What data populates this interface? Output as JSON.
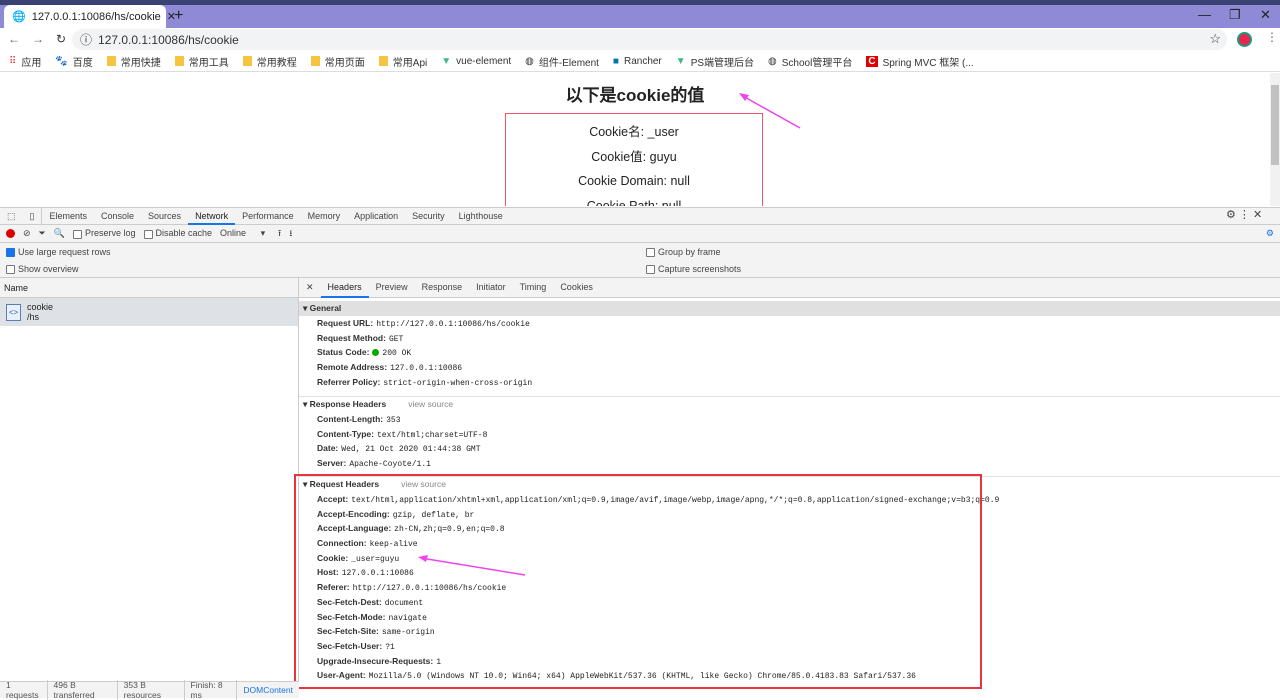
{
  "browser": {
    "tab_title": "127.0.0.1:10086/hs/cookie",
    "url": "127.0.0.1:10086/hs/cookie",
    "bookmarks": [
      {
        "label": "应用",
        "icon": "apps-icon"
      },
      {
        "label": "百度",
        "icon": "baidu-icon"
      },
      {
        "label": "常用快捷",
        "icon": "folder-icon"
      },
      {
        "label": "常用工具",
        "icon": "folder-icon"
      },
      {
        "label": "常用教程",
        "icon": "folder-icon"
      },
      {
        "label": "常用页面",
        "icon": "folder-icon"
      },
      {
        "label": "常用Api",
        "icon": "folder-icon"
      },
      {
        "label": "vue-element",
        "icon": "vue-icon"
      },
      {
        "label": "组件-Element",
        "icon": "globe-icon"
      },
      {
        "label": "Rancher",
        "icon": "rancher-icon"
      },
      {
        "label": "PS端管理后台",
        "icon": "vue-icon"
      },
      {
        "label": "School管理平台",
        "icon": "globe-icon"
      },
      {
        "label": "Spring MVC 框架 (...",
        "icon": "c-icon"
      }
    ]
  },
  "page": {
    "title": "以下是cookie的值",
    "lines": [
      "Cookie名: _user",
      "Cookie值: guyu",
      "Cookie Domain: null",
      "Cookie Path: null"
    ],
    "arrow_color": "#ee44ee",
    "box_color": "#f0536a"
  },
  "devtools": {
    "tabs": [
      "Elements",
      "Console",
      "Sources",
      "Network",
      "Performance",
      "Memory",
      "Application",
      "Security",
      "Lighthouse"
    ],
    "active_tab": "Network",
    "toolbar": {
      "preserve_log": "Preserve log",
      "disable_cache": "Disable cache",
      "throttle": "Online"
    },
    "options": {
      "large_rows": "Use large request rows",
      "large_rows_checked": true,
      "show_overview": "Show overview",
      "group_by_frame": "Group by frame",
      "capture_screenshots": "Capture screenshots"
    },
    "name_header": "Name",
    "request": {
      "name": "cookie",
      "path": "/hs"
    },
    "detail_tabs": [
      "Headers",
      "Preview",
      "Response",
      "Initiator",
      "Timing",
      "Cookies"
    ],
    "active_detail_tab": "Headers",
    "general": {
      "title": "General",
      "rows": [
        [
          "Request URL:",
          "http://127.0.0.1:10086/hs/cookie"
        ],
        [
          "Request Method:",
          "GET"
        ],
        [
          "Status Code:",
          "200 OK"
        ],
        [
          "Remote Address:",
          "127.0.0.1:10086"
        ],
        [
          "Referrer Policy:",
          "strict-origin-when-cross-origin"
        ]
      ]
    },
    "response_headers": {
      "title": "Response Headers",
      "view_source": "view source",
      "rows": [
        [
          "Content-Length:",
          "353"
        ],
        [
          "Content-Type:",
          "text/html;charset=UTF-8"
        ],
        [
          "Date:",
          "Wed, 21 Oct 2020 01:44:38 GMT"
        ],
        [
          "Server:",
          "Apache-Coyote/1.1"
        ]
      ]
    },
    "request_headers": {
      "title": "Request Headers",
      "view_source": "view source",
      "rows": [
        [
          "Accept:",
          "text/html,application/xhtml+xml,application/xml;q=0.9,image/avif,image/webp,image/apng,*/*;q=0.8,application/signed-exchange;v=b3;q=0.9"
        ],
        [
          "Accept-Encoding:",
          "gzip, deflate, br"
        ],
        [
          "Accept-Language:",
          "zh-CN,zh;q=0.9,en;q=0.8"
        ],
        [
          "Connection:",
          "keep-alive"
        ],
        [
          "Cookie:",
          "_user=guyu"
        ],
        [
          "Host:",
          "127.0.0.1:10086"
        ],
        [
          "Referer:",
          "http://127.0.0.1:10086/hs/cookie"
        ],
        [
          "Sec-Fetch-Dest:",
          "document"
        ],
        [
          "Sec-Fetch-Mode:",
          "navigate"
        ],
        [
          "Sec-Fetch-Site:",
          "same-origin"
        ],
        [
          "Sec-Fetch-User:",
          "?1"
        ],
        [
          "Upgrade-Insecure-Requests:",
          "1"
        ],
        [
          "User-Agent:",
          "Mozilla/5.0 (Windows NT 10.0; Win64; x64) AppleWebKit/537.36 (KHTML, like Gecko) Chrome/85.0.4183.83 Safari/537.36"
        ]
      ]
    },
    "status_bar": [
      "1 requests",
      "496 B transferred",
      "353 B resources",
      "Finish: 8 ms",
      "DOMContent"
    ]
  }
}
